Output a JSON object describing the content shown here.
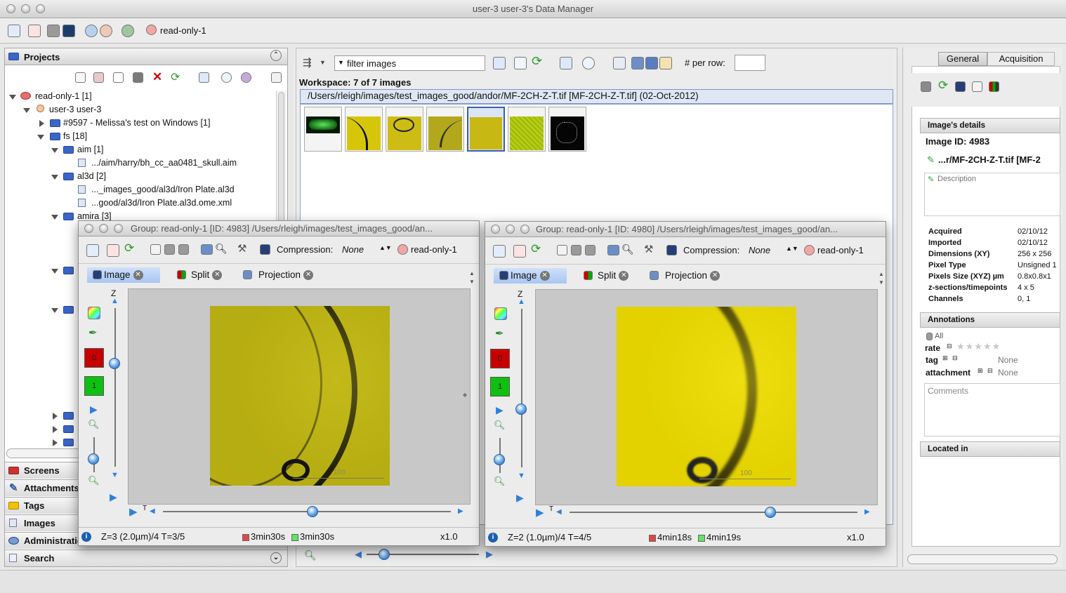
{
  "window": {
    "title": "user-3 user-3's Data Manager"
  },
  "toolbar": {
    "group_label": "read-only-1"
  },
  "left": {
    "header": "Projects",
    "tree": [
      {
        "label": "read-only-1 [1]"
      },
      {
        "label": "user-3 user-3"
      },
      {
        "label": "#9597 - Melissa's test on Windows [1]"
      },
      {
        "label": "fs [18]"
      },
      {
        "label": "aim [1]"
      },
      {
        "label": ".../aim/harry/bh_cc_aa0481_skull.aim"
      },
      {
        "label": "al3d [2]"
      },
      {
        "label": "..._images_good/al3d/Iron Plate.al3d"
      },
      {
        "label": "...good/al3d/Iron Plate.al3d.ome.xml"
      },
      {
        "label": "amira [3]"
      }
    ],
    "accordion": [
      "Screens",
      "Attachments",
      "Tags",
      "Images",
      "Administration",
      "Search"
    ]
  },
  "center": {
    "filter_value": "filter  images",
    "per_row_label": "# per row:",
    "workspace_label": "Workspace: 7 of 7 images",
    "path": "/Users/rleigh/images/test_images_good/andor/MF-2CH-Z-T.tif [MF-2CH-Z-T.tif] (02-Oct-2012)"
  },
  "right": {
    "tabs": [
      "General",
      "Acquisition"
    ],
    "details_header": "Image's details",
    "image_id": "Image ID: 4983",
    "image_name": "...r/MF-2CH-Z-T.tif [MF-2",
    "description_placeholder": "Description",
    "props": [
      {
        "k": "Acquired",
        "v": "02/10/12"
      },
      {
        "k": "Imported",
        "v": "02/10/12"
      },
      {
        "k": "Dimensions (XY)",
        "v": "256 x 256"
      },
      {
        "k": "Pixel Type",
        "v": "Unsigned 1"
      },
      {
        "k": "Pixels Size (XYZ) µm",
        "v": "0.8x0.8x1"
      },
      {
        "k": "z-sections/timepoints",
        "v": "4 x 5"
      },
      {
        "k": "Channels",
        "v": "0, 1"
      }
    ],
    "annotations_header": "Annotations",
    "all_label": "All",
    "rate_label": "rate",
    "tag_label": "tag",
    "tag_value": "None",
    "attachment_label": "attachment",
    "attachment_value": "None",
    "comments_placeholder": "Comments",
    "located_header": "Located in"
  },
  "viewer1": {
    "title": "Group: read-only-1 [ID: 4983] /Users/rleigh/images/test_images_good/an...",
    "compression_label": "Compression:",
    "compression_value": "None",
    "group": "read-only-1",
    "tabs": [
      "Image",
      "Split",
      "Projection"
    ],
    "z_label": "Z",
    "t_label": "T",
    "ch0": "0",
    "ch1": "1",
    "status_zt": "Z=3 (2.0µm)/4 T=3/5",
    "time0": "3min30s",
    "time1": "3min30s",
    "zoom": "x1.0",
    "scalebar": "100"
  },
  "viewer2": {
    "title": "Group: read-only-1 [ID: 4980] /Users/rleigh/images/test_images_good/an...",
    "compression_label": "Compression:",
    "compression_value": "None",
    "group": "read-only-1",
    "tabs": [
      "Image",
      "Split",
      "Projection"
    ],
    "z_label": "Z",
    "t_label": "T",
    "ch0": "0",
    "ch1": "1",
    "status_zt": "Z=2 (1.0µm)/4 T=4/5",
    "time0": "4min18s",
    "time1": "4min19s",
    "zoom": "x1.0",
    "scalebar": "100"
  },
  "colors": {
    "channel0": "#c40000",
    "channel1": "#16b816",
    "selection": "#a8c6f3",
    "micro_yellow": "#d8c800"
  }
}
